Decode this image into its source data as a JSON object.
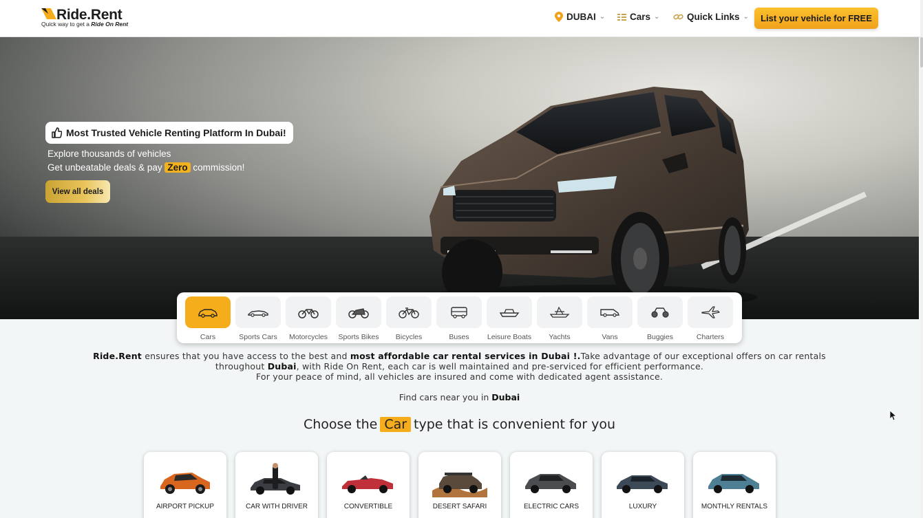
{
  "header": {
    "logo_text": "Ride.Rent",
    "logo_tagline_prefix": "Quick way to get a",
    "logo_tagline_emph": "Ride On Rent",
    "location": "DUBAI",
    "vehicle_menu": "Cars",
    "quick_links": "Quick Links",
    "cta": "List your vehicle for FREE"
  },
  "hero": {
    "badge": "Most Trusted Vehicle Renting Platform In Dubai!",
    "line1": "Explore thousands of vehicles",
    "line2_prefix": "Get unbeatable deals & pay",
    "line2_highlight": "Zero",
    "line2_suffix": "commission!",
    "button": "View all deals"
  },
  "categories": [
    {
      "label": "Cars",
      "icon": "car-icon",
      "active": true
    },
    {
      "label": "Sports Cars",
      "icon": "sports-car-icon",
      "active": false
    },
    {
      "label": "Motorcycles",
      "icon": "motorcycle-icon",
      "active": false
    },
    {
      "label": "Sports Bikes",
      "icon": "sports-bike-icon",
      "active": false
    },
    {
      "label": "Bicycles",
      "icon": "bicycle-icon",
      "active": false
    },
    {
      "label": "Buses",
      "icon": "bus-icon",
      "active": false
    },
    {
      "label": "Leisure Boats",
      "icon": "boat-icon",
      "active": false
    },
    {
      "label": "Yachts",
      "icon": "yacht-icon",
      "active": false
    },
    {
      "label": "Vans",
      "icon": "van-icon",
      "active": false
    },
    {
      "label": "Buggies",
      "icon": "buggy-icon",
      "active": false
    },
    {
      "label": "Charters",
      "icon": "airplane-icon",
      "active": false
    }
  ],
  "description": {
    "brand": "Ride.Rent",
    "p1": "ensures that you have access to the best and",
    "p1_bold": "most affordable car rental services in Dubai !.",
    "p1_rest": "Take advantage of our exceptional offers on car rentals",
    "p2_prefix": "throughout",
    "p2_bold": "Dubai",
    "p2_rest": ", with Ride On Rent, each car is well maintained and pre-serviced for efficient performance.",
    "p3": "For your peace of mind, all vehicles are insured and come with dedicated agent assistance."
  },
  "near": {
    "prefix": "Find cars near you in",
    "city": "Dubai"
  },
  "choose": {
    "prefix": "Choose the",
    "highlight": "Car",
    "suffix": "type that is convenient for you"
  },
  "car_types": [
    {
      "label": "AIRPORT PICKUP",
      "color": "#d9661f"
    },
    {
      "label": "CAR WITH DRIVER",
      "color": "#3a3d42"
    },
    {
      "label": "CONVERTIBLE",
      "color": "#c0303a"
    },
    {
      "label": "DESERT SAFARI",
      "color": "#8a5a2f"
    },
    {
      "label": "ELECTRIC CARS",
      "color": "#4a4c50"
    },
    {
      "label": "LUXURY",
      "color": "#3c4a58"
    },
    {
      "label": "MONTHLY RENTALS",
      "color": "#4f7f95"
    }
  ],
  "colors": {
    "accent": "#f5ad1b",
    "page_bg": "#f3f6f7"
  }
}
